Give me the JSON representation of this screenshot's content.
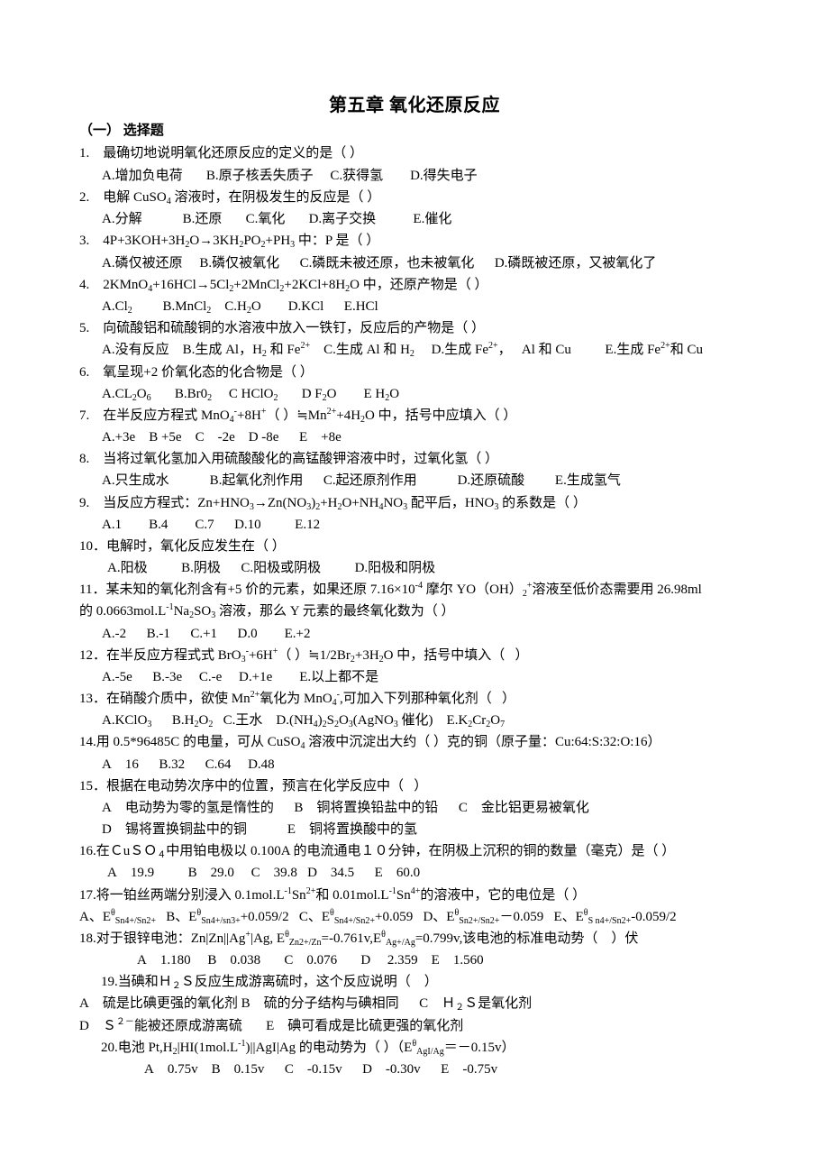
{
  "document": {
    "title": "第五章  氧化还原反应",
    "section": "（一）    选择题",
    "lines": [
      {
        "id": "q1",
        "html": "1.&nbsp;&nbsp;&nbsp;&nbsp;最确切地说明氧化还原反应的定义的是（ ）"
      },
      {
        "id": "q1-opts",
        "html": "A.增加负电荷&nbsp;&nbsp;&nbsp;&nbsp;&nbsp;&nbsp;&nbsp;B.原子核丢失质子&nbsp;&nbsp;&nbsp;&nbsp;&nbsp;C.获得氢&nbsp;&nbsp;&nbsp;&nbsp;&nbsp;&nbsp;&nbsp;&nbsp;D.得失电子"
      },
      {
        "id": "q2",
        "html": "2.&nbsp;&nbsp;&nbsp;&nbsp;电解 CuSO<sub>4</sub> 溶液时，在阴极发生的反应是（ ）"
      },
      {
        "id": "q2-opts",
        "html": "A.分解&nbsp;&nbsp;&nbsp;&nbsp;&nbsp;&nbsp;&nbsp;&nbsp;&nbsp;&nbsp;&nbsp;&nbsp;B.还原&nbsp;&nbsp;&nbsp;&nbsp;&nbsp;&nbsp;&nbsp;C.氧化&nbsp;&nbsp;&nbsp;&nbsp;&nbsp;&nbsp;&nbsp;D.离子交换&nbsp;&nbsp;&nbsp;&nbsp;&nbsp;&nbsp;&nbsp;&nbsp;&nbsp;&nbsp;&nbsp;E.催化"
      },
      {
        "id": "q3",
        "html": "3.&nbsp;&nbsp;&nbsp;&nbsp;4P+3KOH+3H<sub>2</sub>O→3KH<sub>2</sub>PO<sub>2</sub>+PH<sub>3</sub> 中：P 是（ ）"
      },
      {
        "id": "q3-opts",
        "html": "A.磷仅被还原&nbsp;&nbsp;&nbsp;&nbsp;&nbsp;B.磷仅被氧化&nbsp;&nbsp;&nbsp;&nbsp;&nbsp;&nbsp;C.磷既未被还原，也未被氧化&nbsp;&nbsp;&nbsp;&nbsp;&nbsp;&nbsp;D.磷既被还原，又被氧化了"
      },
      {
        "id": "q4",
        "html": "4.&nbsp;&nbsp;&nbsp;&nbsp;2KMnO<sub>4</sub>+16HCl→5Cl<sub>2</sub>+2MnCl<sub>2</sub>+2KCl+8H<sub>2</sub>O 中，还原产物是（ ）"
      },
      {
        "id": "q4-opts",
        "html": "A.Cl<sub>2</sub>&nbsp;&nbsp;&nbsp;&nbsp;&nbsp;&nbsp;&nbsp;&nbsp;&nbsp;B.MnCl<sub>2</sub>&nbsp;&nbsp;&nbsp;&nbsp;C.H<sub>2</sub>O&nbsp;&nbsp;&nbsp;&nbsp;&nbsp;&nbsp;&nbsp;&nbsp;D.KCl&nbsp;&nbsp;&nbsp;&nbsp;&nbsp;&nbsp;E.HCl"
      },
      {
        "id": "q5",
        "html": "5.&nbsp;&nbsp;&nbsp;&nbsp;向硫酸铝和硫酸铜的水溶液中放入一铁钉，反应后的产物是（ ）"
      },
      {
        "id": "q5-opts",
        "html": "A.没有反应&nbsp;&nbsp;&nbsp;&nbsp;B.生成 Al，H<sub>2</sub> 和 Fe<sup>2+</sup>&nbsp;&nbsp;&nbsp;&nbsp;C.生成 Al 和 H<sub>2</sub>&nbsp;&nbsp;&nbsp;&nbsp;&nbsp;D.生成 Fe<sup>2+</sup>，&nbsp;&nbsp;&nbsp;Al 和 Cu&nbsp;&nbsp;&nbsp;&nbsp;&nbsp;&nbsp;&nbsp;&nbsp;&nbsp;&nbsp;E.生成 Fe<sup>2+</sup>和 Cu"
      },
      {
        "id": "q6",
        "html": "6.&nbsp;&nbsp;&nbsp;&nbsp;氧呈现+2 价氧化态的化合物是（ ）"
      },
      {
        "id": "q6-opts",
        "html": "A.CL<sub>2</sub>O<sub>6</sub>&nbsp;&nbsp;&nbsp;&nbsp;&nbsp;&nbsp;&nbsp;B.Br0<sub>2</sub>&nbsp;&nbsp;&nbsp;&nbsp;&nbsp;C HClO<sub>2</sub>&nbsp;&nbsp;&nbsp;&nbsp;&nbsp;&nbsp;&nbsp;D F<sub>2</sub>O&nbsp;&nbsp;&nbsp;&nbsp;&nbsp;&nbsp;&nbsp;&nbsp;E H<sub>2</sub>O"
      },
      {
        "id": "q7",
        "html": "7.&nbsp;&nbsp;&nbsp;&nbsp;在半反应方程式 MnO<sub>4</sub><sup>-</sup>+8H<sup>+</sup>（ ）≒Mn<sup>2+</sup>+4H<sub>2</sub>O 中，括号中应填入（ ）"
      },
      {
        "id": "q7-opts",
        "html": "A.+3e&nbsp;&nbsp;&nbsp;&nbsp;B +5e&nbsp;&nbsp;&nbsp;&nbsp;C&nbsp;&nbsp;&nbsp;&nbsp;-2e&nbsp;&nbsp;&nbsp;&nbsp;D -8e&nbsp;&nbsp;&nbsp;&nbsp;&nbsp;&nbsp;E&nbsp;&nbsp;&nbsp;&nbsp;+8e"
      },
      {
        "id": "q8",
        "html": "8.&nbsp;&nbsp;&nbsp;&nbsp;当将过氧化氢加入用硫酸酸化的高锰酸钾溶液中时，过氧化氢（ ）"
      },
      {
        "id": "q8-opts",
        "html": "A.只生成水&nbsp;&nbsp;&nbsp;&nbsp;&nbsp;&nbsp;&nbsp;&nbsp;&nbsp;&nbsp;&nbsp;&nbsp;B.起氧化剂作用&nbsp;&nbsp;&nbsp;&nbsp;&nbsp;&nbsp;C.起还原剂作用&nbsp;&nbsp;&nbsp;&nbsp;&nbsp;&nbsp;&nbsp;&nbsp;&nbsp;&nbsp;&nbsp;&nbsp;D.还原硫酸&nbsp;&nbsp;&nbsp;&nbsp;&nbsp;&nbsp;&nbsp;&nbsp;&nbsp;E.生成氢气"
      },
      {
        "id": "q9",
        "html": "9.&nbsp;&nbsp;&nbsp;&nbsp;当反应方程式：Zn+HNO<sub>3</sub>→Zn(NO<sub>3</sub>)<sub>2</sub>+H<sub>2</sub>O+NH<sub>4</sub>NO<sub>3</sub> 配平后，HNO<sub>3</sub> 的系数是（ ）"
      },
      {
        "id": "q9-opts",
        "html": "A.1&nbsp;&nbsp;&nbsp;&nbsp;&nbsp;&nbsp;&nbsp;&nbsp;B.4&nbsp;&nbsp;&nbsp;&nbsp;&nbsp;&nbsp;&nbsp;&nbsp;C.7&nbsp;&nbsp;&nbsp;&nbsp;&nbsp;&nbsp;D.10&nbsp;&nbsp;&nbsp;&nbsp;&nbsp;&nbsp;&nbsp;&nbsp;&nbsp;&nbsp;E.12"
      },
      {
        "id": "q10",
        "html": "10．电解时，氧化反应发生在（ ）"
      },
      {
        "id": "q10-opts",
        "html": "A.阳极&nbsp;&nbsp;&nbsp;&nbsp;&nbsp;&nbsp;&nbsp;&nbsp;&nbsp;&nbsp;B.阴极&nbsp;&nbsp;&nbsp;&nbsp;&nbsp;&nbsp;C.阳极或阴极&nbsp;&nbsp;&nbsp;&nbsp;&nbsp;&nbsp;&nbsp;&nbsp;&nbsp;&nbsp;D.阳极和阴极"
      },
      {
        "id": "q11",
        "html": "11．某未知的氧化剂含有+5 价的元素，如果还原 7.16×10<sup>-4</sup> 摩尔 YO（OH）<sub>2</sub><sup>+</sup>溶液至低价态需要用 26.98ml"
      },
      {
        "id": "q11-cont",
        "html": "的 0.0663mol.L<sup>-1</sup>Na<sub>2</sub>SO<sub>3</sub> 溶液，那么 Y 元素的最终氧化数为（ ）"
      },
      {
        "id": "q11-opts",
        "html": "A.-2&nbsp;&nbsp;&nbsp;&nbsp;&nbsp;&nbsp;B.-1&nbsp;&nbsp;&nbsp;&nbsp;&nbsp;&nbsp;C.+1&nbsp;&nbsp;&nbsp;&nbsp;&nbsp;&nbsp;D.0&nbsp;&nbsp;&nbsp;&nbsp;&nbsp;&nbsp;&nbsp;&nbsp;E.+2"
      },
      {
        "id": "q12",
        "html": "12．在半反应方程式式 BrO<sub>3</sub><sup>-</sup>+6H<sup>+</sup>（ ）≒1/2Br<sub>2</sub>+3H<sub>2</sub>O 中，括号中填入（&nbsp;&nbsp;&nbsp;）"
      },
      {
        "id": "q12-opts",
        "html": "A.-5e&nbsp;&nbsp;&nbsp;&nbsp;&nbsp;&nbsp;B.-3e&nbsp;&nbsp;&nbsp;&nbsp;&nbsp;C.-e&nbsp;&nbsp;&nbsp;&nbsp;&nbsp;D.+1e&nbsp;&nbsp;&nbsp;&nbsp;&nbsp;&nbsp;&nbsp;&nbsp;E.以上都不是"
      },
      {
        "id": "q13",
        "html": "13．在硝酸介质中，欲使 Mn<sup>2+</sup>氧化为 MnO<sub>4</sub><sup>-</sup>,可加入下列那种氧化剂（&nbsp;&nbsp;&nbsp;）"
      },
      {
        "id": "q13-opts",
        "html": "A.KClO<sub>3</sub>&nbsp;&nbsp;&nbsp;&nbsp;&nbsp;&nbsp;B.H<sub>2</sub>O<sub>2</sub>&nbsp;&nbsp;&nbsp;C.王水&nbsp;&nbsp;&nbsp;&nbsp;D.(NH<sub>4</sub>)<sub>2</sub>S<sub>2</sub>O<sub>3</sub>(AgNO<sub>3</sub> 催化)&nbsp;&nbsp;&nbsp;&nbsp;E.K<sub>2</sub>Cr<sub>2</sub>O<sub>7</sub>"
      },
      {
        "id": "q14",
        "html": "14.用 0.5*96485C 的电量，可从 CuSO<sub>4</sub> 溶液中沉淀出大约（ ）克的铜（原子量：Cu:64:S:32:O:16）"
      },
      {
        "id": "q14-opts",
        "html": "A&nbsp;&nbsp;&nbsp;&nbsp;16&nbsp;&nbsp;&nbsp;&nbsp;&nbsp;&nbsp;B.32&nbsp;&nbsp;&nbsp;&nbsp;&nbsp;&nbsp;C.64&nbsp;&nbsp;&nbsp;&nbsp;&nbsp;D.48"
      },
      {
        "id": "q15",
        "html": "15．根据在电动势次序中的位置，预言在化学反应中（&nbsp;&nbsp;&nbsp;）"
      },
      {
        "id": "q15-opts1",
        "html": "A&nbsp;&nbsp;&nbsp;&nbsp;电动势为零的氢是惰性的&nbsp;&nbsp;&nbsp;&nbsp;&nbsp;&nbsp;B&nbsp;&nbsp;&nbsp;&nbsp;铜将置换铅盐中的铅&nbsp;&nbsp;&nbsp;&nbsp;&nbsp;&nbsp;C&nbsp;&nbsp;&nbsp;&nbsp;金比铝更易被氧化"
      },
      {
        "id": "q15-opts2",
        "html": "D&nbsp;&nbsp;&nbsp;&nbsp;锡将置换铜盐中的铜&nbsp;&nbsp;&nbsp;&nbsp;&nbsp;&nbsp;&nbsp;&nbsp;&nbsp;&nbsp;&nbsp;&nbsp;E&nbsp;&nbsp;&nbsp;&nbsp;铜将置换酸中的氢"
      },
      {
        "id": "q16",
        "html": "16.在ＣuＳＯ<sub>４</sub>中用铂电极以 0.100A 的电流通电１０分钟，在阴极上沉积的铜的数量（毫克）是（ ）"
      },
      {
        "id": "q16-opts",
        "html": "A&nbsp;&nbsp;&nbsp;&nbsp;19.9&nbsp;&nbsp;&nbsp;&nbsp;&nbsp;&nbsp;&nbsp;&nbsp;&nbsp;&nbsp;B&nbsp;&nbsp;&nbsp;&nbsp;29.0&nbsp;&nbsp;&nbsp;&nbsp;&nbsp;C&nbsp;&nbsp;&nbsp;&nbsp;39.8&nbsp;&nbsp;&nbsp;D&nbsp;&nbsp;&nbsp;&nbsp;34.5&nbsp;&nbsp;&nbsp;&nbsp;&nbsp;&nbsp;E&nbsp;&nbsp;&nbsp;&nbsp;60.0"
      },
      {
        "id": "q17",
        "html": "17.将一铂丝两端分别浸入 0.1mol.L<sup>-1</sup>Sn<sup>2+</sup>和 0.01mol.L<sup>-1</sup>Sn<sup>4+</sup>的溶液中，它的电位是（ ）"
      },
      {
        "id": "q17-opts",
        "html": "A、E<sup>θ</sup><sub>Sn4+/Sn2+</sub>&nbsp;&nbsp;&nbsp;B、E<sup>θ</sup><sub>Sn4+/sn3+</sub>+0.059/2&nbsp;&nbsp;&nbsp;C、E<sup>θ</sup><sub>Sn4+/Sn2+</sub>+0.059&nbsp;&nbsp;&nbsp;D、E<sup>θ</sup><sub>Sn2+/Sn2+</sub>－0.059&nbsp;&nbsp;&nbsp;E、E<sup>θ</sup><sub>S n4+/Sn2+</sub>-0.059/2"
      },
      {
        "id": "q18",
        "html": "18.对于银锌电池：Zn|Zn||Ag<sup>+</sup>|Ag, E<sup>θ</sup><sub>Zn2+/Zn</sub>=-0.761v,E<sup>θ</sup><sub>Ag+/Ag</sub>=0.799v,该电池的标准电动势（&nbsp;&nbsp;&nbsp;&nbsp;）伏"
      },
      {
        "id": "q18-opts",
        "html": "A&nbsp;&nbsp;&nbsp;&nbsp;1.180&nbsp;&nbsp;&nbsp;&nbsp;&nbsp;B&nbsp;&nbsp;&nbsp;&nbsp;0.038&nbsp;&nbsp;&nbsp;&nbsp;&nbsp;&nbsp;&nbsp;C&nbsp;&nbsp;&nbsp;&nbsp;0.076&nbsp;&nbsp;&nbsp;&nbsp;&nbsp;&nbsp;&nbsp;D&nbsp;&nbsp;&nbsp;&nbsp;&nbsp;2.359&nbsp;&nbsp;&nbsp;&nbsp;E&nbsp;&nbsp;&nbsp;&nbsp;1.560"
      },
      {
        "id": "q19",
        "html": "19.当碘和Ｈ<sub>２</sub>Ｓ反应生成游离硫时，这个反应说明（&nbsp;&nbsp;&nbsp;&nbsp;）"
      },
      {
        "id": "q19-opts1",
        "html": "A&nbsp;&nbsp;&nbsp;&nbsp;硫是比碘更强的氧化剂 B&nbsp;&nbsp;&nbsp;&nbsp;硫的分子结构与碘相同&nbsp;&nbsp;&nbsp;&nbsp;&nbsp;&nbsp;C&nbsp;&nbsp;&nbsp;&nbsp;Ｈ<sub>２</sub>Ｓ是氧化剂"
      },
      {
        "id": "q19-opts2",
        "html": "D&nbsp;&nbsp;&nbsp;&nbsp;Ｓ<sup>２－</sup>能被还原成游离硫&nbsp;&nbsp;&nbsp;&nbsp;&nbsp;&nbsp;&nbsp;E&nbsp;&nbsp;&nbsp;&nbsp;碘可看成是比硫更强的氧化剂"
      },
      {
        "id": "q20",
        "html": "20.电池 Pt,H<sub>2</sub>|HI(1mol.L<sup>-1</sup>)||AgI|Ag 的电动势为（ ）（E<sup>θ</sup><sub>AgI/Ag</sub>＝－0.15v）"
      },
      {
        "id": "q20-opts",
        "html": "A&nbsp;&nbsp;&nbsp;&nbsp;0.75v&nbsp;&nbsp;&nbsp;&nbsp;B&nbsp;&nbsp;&nbsp;&nbsp;0.15v&nbsp;&nbsp;&nbsp;&nbsp;&nbsp;&nbsp;C&nbsp;&nbsp;&nbsp;&nbsp;-0.15v&nbsp;&nbsp;&nbsp;&nbsp;&nbsp;&nbsp;D&nbsp;&nbsp;&nbsp;&nbsp;-0.30v&nbsp;&nbsp;&nbsp;&nbsp;&nbsp;&nbsp;E&nbsp;&nbsp;&nbsp;&nbsp;-0.75v"
      }
    ]
  }
}
